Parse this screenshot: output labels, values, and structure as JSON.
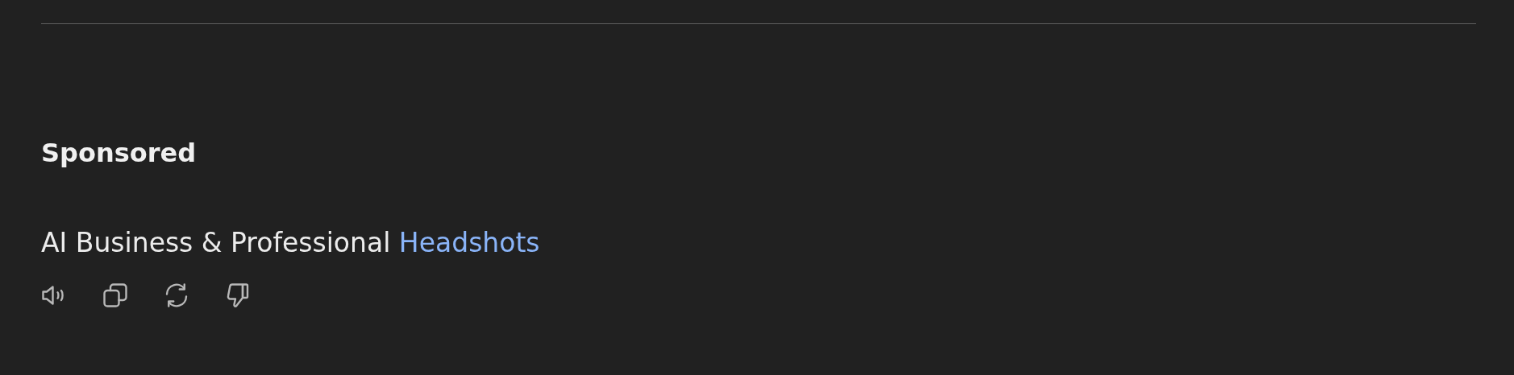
{
  "section_heading": "Sponsored",
  "ad": {
    "text": "AI Business & Professional",
    "link": "Headshots"
  },
  "actions": [
    {
      "kind": "speaker"
    },
    {
      "kind": "copy"
    },
    {
      "kind": "refresh"
    },
    {
      "kind": "dislike"
    }
  ]
}
